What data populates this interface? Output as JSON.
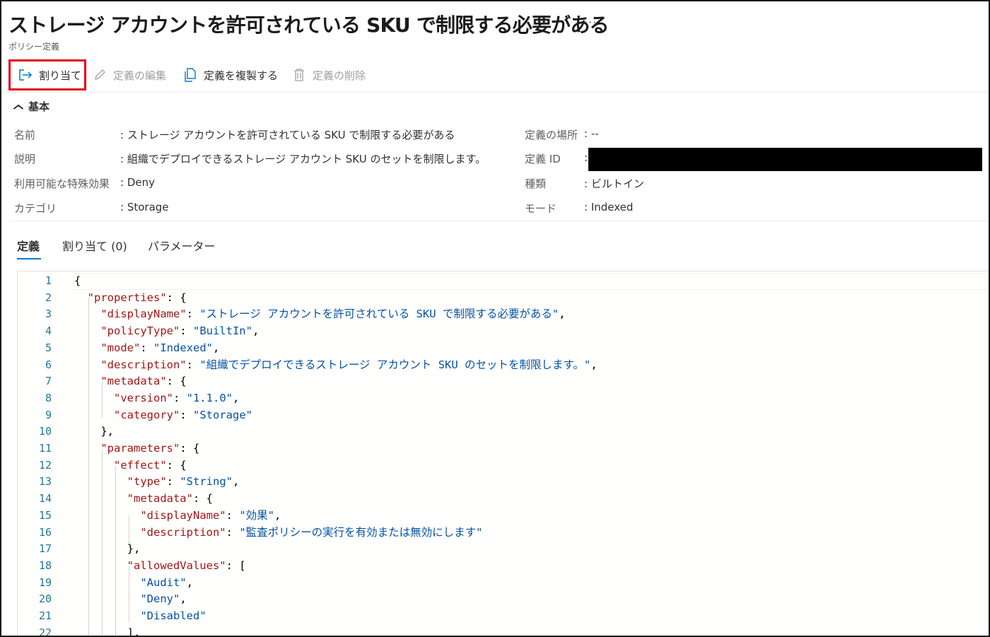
{
  "title": "ストレージ アカウントを許可されている SKU で制限する必要がある",
  "more_label": "···",
  "subtitle": "ポリシー定義",
  "toolbar": {
    "assign": "割り当て",
    "edit": "定義の編集",
    "duplicate": "定義を複製する",
    "delete": "定義の削除"
  },
  "basics": {
    "heading": "基本",
    "name_label": "名前",
    "name_value": ": ストレージ アカウントを許可されている SKU で制限する必要がある",
    "desc_label": "説明",
    "desc_value": ": 組織でデプロイできるストレージ アカウント SKU のセットを制限します。",
    "effects_label": "利用可能な特殊効果",
    "effects_value": ": Deny",
    "category_label": "カテゴリ",
    "category_value": ": Storage",
    "location_label": "定義の場所",
    "location_value": ": --",
    "id_label": "定義 ID",
    "id_value": ":",
    "type_label": "種類",
    "type_value": ": ビルトイン",
    "mode_label": "モード",
    "mode_value": ": Indexed"
  },
  "tabs": [
    "定義",
    "割り当て (0)",
    "パラメーター"
  ],
  "code": {
    "line_numbers": [
      "1",
      "2",
      "3",
      "4",
      "5",
      "6",
      "7",
      "8",
      "9",
      "10",
      "11",
      "12",
      "13",
      "14",
      "15",
      "16",
      "17",
      "18",
      "19",
      "20",
      "21",
      "22"
    ],
    "lines": [
      {
        "indent": "",
        "parts": [
          [
            "p",
            "{"
          ]
        ]
      },
      {
        "indent": "  ",
        "parts": [
          [
            "k",
            "\"properties\""
          ],
          [
            "p",
            ": {"
          ]
        ]
      },
      {
        "indent": "    ",
        "parts": [
          [
            "k",
            "\"displayName\""
          ],
          [
            "p",
            ": "
          ],
          [
            "s",
            "\"ストレージ アカウントを許可されている SKU で制限する必要がある\""
          ],
          [
            "p",
            ","
          ]
        ]
      },
      {
        "indent": "    ",
        "parts": [
          [
            "k",
            "\"policyType\""
          ],
          [
            "p",
            ": "
          ],
          [
            "s",
            "\"BuiltIn\""
          ],
          [
            "p",
            ","
          ]
        ]
      },
      {
        "indent": "    ",
        "parts": [
          [
            "k",
            "\"mode\""
          ],
          [
            "p",
            ": "
          ],
          [
            "s",
            "\"Indexed\""
          ],
          [
            "p",
            ","
          ]
        ]
      },
      {
        "indent": "    ",
        "parts": [
          [
            "k",
            "\"description\""
          ],
          [
            "p",
            ": "
          ],
          [
            "s",
            "\"組織でデプロイできるストレージ アカウント SKU のセットを制限します。\""
          ],
          [
            "p",
            ","
          ]
        ]
      },
      {
        "indent": "    ",
        "parts": [
          [
            "k",
            "\"metadata\""
          ],
          [
            "p",
            ": {"
          ]
        ]
      },
      {
        "indent": "      ",
        "parts": [
          [
            "k",
            "\"version\""
          ],
          [
            "p",
            ": "
          ],
          [
            "s",
            "\"1.1.0\""
          ],
          [
            "p",
            ","
          ]
        ]
      },
      {
        "indent": "      ",
        "parts": [
          [
            "k",
            "\"category\""
          ],
          [
            "p",
            ": "
          ],
          [
            "s",
            "\"Storage\""
          ]
        ]
      },
      {
        "indent": "    ",
        "parts": [
          [
            "p",
            "},"
          ]
        ]
      },
      {
        "indent": "    ",
        "parts": [
          [
            "k",
            "\"parameters\""
          ],
          [
            "p",
            ": {"
          ]
        ]
      },
      {
        "indent": "      ",
        "parts": [
          [
            "k",
            "\"effect\""
          ],
          [
            "p",
            ": {"
          ]
        ]
      },
      {
        "indent": "        ",
        "parts": [
          [
            "k",
            "\"type\""
          ],
          [
            "p",
            ": "
          ],
          [
            "s",
            "\"String\""
          ],
          [
            "p",
            ","
          ]
        ]
      },
      {
        "indent": "        ",
        "parts": [
          [
            "k",
            "\"metadata\""
          ],
          [
            "p",
            ": {"
          ]
        ]
      },
      {
        "indent": "          ",
        "parts": [
          [
            "k",
            "\"displayName\""
          ],
          [
            "p",
            ": "
          ],
          [
            "s",
            "\"効果\""
          ],
          [
            "p",
            ","
          ]
        ]
      },
      {
        "indent": "          ",
        "parts": [
          [
            "k",
            "\"description\""
          ],
          [
            "p",
            ": "
          ],
          [
            "s",
            "\"監査ポリシーの実行を有効または無効にします\""
          ]
        ]
      },
      {
        "indent": "        ",
        "parts": [
          [
            "p",
            "},"
          ]
        ]
      },
      {
        "indent": "        ",
        "parts": [
          [
            "k",
            "\"allowedValues\""
          ],
          [
            "p",
            ": ["
          ]
        ]
      },
      {
        "indent": "          ",
        "parts": [
          [
            "s",
            "\"Audit\""
          ],
          [
            "p",
            ","
          ]
        ]
      },
      {
        "indent": "          ",
        "parts": [
          [
            "s",
            "\"Deny\""
          ],
          [
            "p",
            ","
          ]
        ]
      },
      {
        "indent": "          ",
        "parts": [
          [
            "s",
            "\"Disabled\""
          ]
        ]
      },
      {
        "indent": "        ",
        "parts": [
          [
            "p",
            "],"
          ]
        ]
      }
    ]
  },
  "colors": {
    "accent": "#0078d4",
    "highlight_box": "#e3000f",
    "json_key": "#a31515",
    "json_string": "#0451a5",
    "line_number": "#237893"
  },
  "icons": [
    "assign-icon",
    "edit-pencil-icon",
    "duplicate-icon",
    "trash-icon",
    "chevron-up-icon"
  ]
}
